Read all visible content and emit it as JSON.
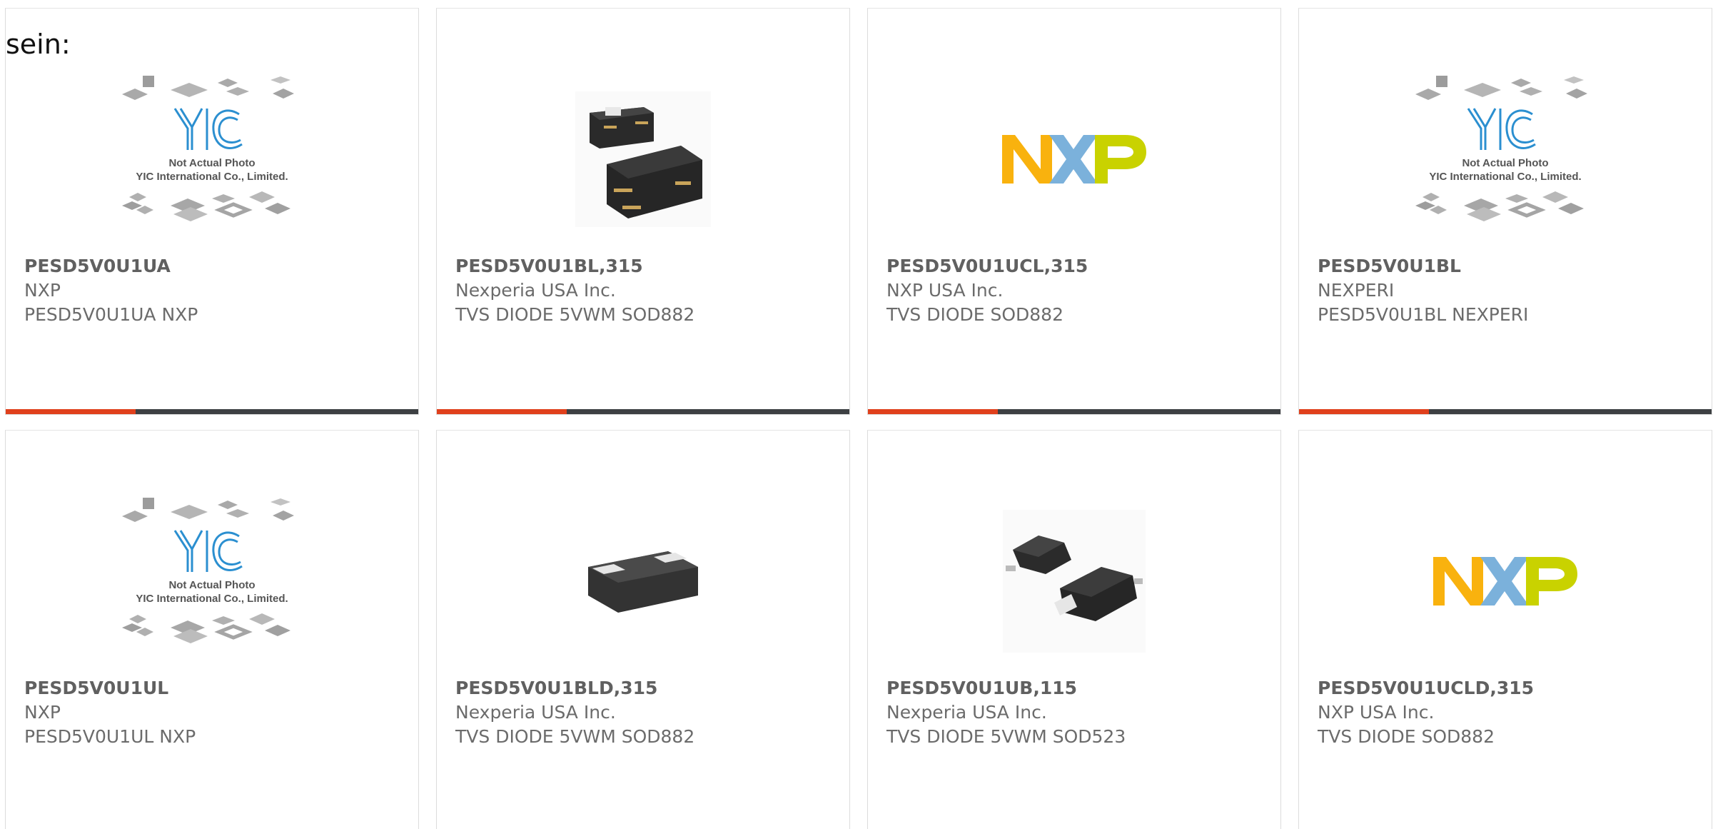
{
  "intro_text": "sein:",
  "placeholder_photo": {
    "line1": "Not Actual Photo",
    "line2": "YIC International Co., Limited.",
    "logo_text": "YIC"
  },
  "nxp_logo_text": "NXP",
  "products": [
    {
      "part": "PESD5V0U1UA",
      "maker": "NXP",
      "desc": "PESD5V0U1UA NXP",
      "image": "yic-placeholder",
      "bar": true
    },
    {
      "part": "PESD5V0U1BL,315",
      "maker": "Nexperia USA Inc.",
      "desc": "TVS DIODE 5VWM SOD882",
      "image": "sod882-two-chips",
      "bar": true
    },
    {
      "part": "PESD5V0U1UCL,315",
      "maker": "NXP USA Inc.",
      "desc": "TVS DIODE SOD882",
      "image": "nxp-logo",
      "bar": true
    },
    {
      "part": "PESD5V0U1BL",
      "maker": "NEXPERI",
      "desc": "PESD5V0U1BL NEXPERI",
      "image": "yic-placeholder",
      "bar": true
    },
    {
      "part": "PESD5V0U1UL",
      "maker": "NXP",
      "desc": "PESD5V0U1UL NXP",
      "image": "yic-placeholder",
      "bar": false
    },
    {
      "part": "PESD5V0U1BLD,315",
      "maker": "Nexperia USA Inc.",
      "desc": "TVS DIODE 5VWM SOD882",
      "image": "sod882-single-chip",
      "bar": false
    },
    {
      "part": "PESD5V0U1UB,115",
      "maker": "Nexperia USA Inc.",
      "desc": "TVS DIODE 5VWM SOD523",
      "image": "sod523-chips",
      "bar": false
    },
    {
      "part": "PESD5V0U1UCLD,315",
      "maker": "NXP USA Inc.",
      "desc": "TVS DIODE SOD882",
      "image": "nxp-logo",
      "bar": false
    }
  ],
  "colors": {
    "accent": "#e0401c",
    "bar_dark": "#3d4043",
    "yic_blue": "#2b8fd0",
    "nxp_orange": "#f9b20e",
    "nxp_blue": "#7bb1db",
    "nxp_green": "#c9d200"
  }
}
